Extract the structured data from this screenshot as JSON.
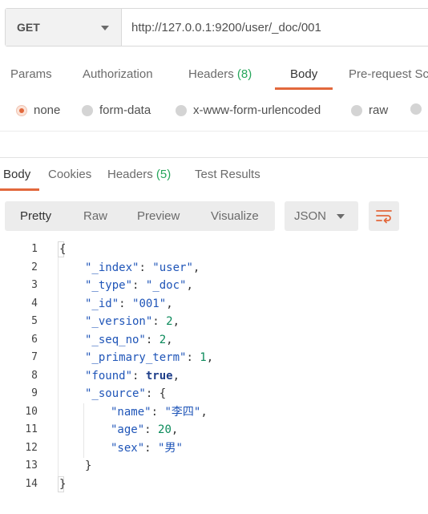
{
  "request": {
    "method": "GET",
    "url": "http://127.0.0.1:9200/user/_doc/001"
  },
  "request_tabs": [
    {
      "label": "Params"
    },
    {
      "label": "Authorization"
    },
    {
      "label": "Headers",
      "count": "(8)"
    },
    {
      "label": "Body",
      "active": true
    },
    {
      "label": "Pre-request Sc"
    }
  ],
  "body_types": [
    {
      "label": "none",
      "selected": true
    },
    {
      "label": "form-data"
    },
    {
      "label": "x-www-form-urlencoded"
    },
    {
      "label": "raw"
    }
  ],
  "response_tabs": [
    {
      "label": "Body",
      "active": true
    },
    {
      "label": "Cookies"
    },
    {
      "label": "Headers",
      "count": "(5)"
    },
    {
      "label": "Test Results"
    }
  ],
  "view_modes": [
    "Pretty",
    "Raw",
    "Preview",
    "Visualize"
  ],
  "format": "JSON",
  "accent_color": "#e2683c",
  "count_color": "#26a65b",
  "icons": {
    "method_dropdown": "chevron-down-icon",
    "format_dropdown": "chevron-down-icon",
    "wrap": "wrap-lines-icon"
  },
  "response_json": {
    "_index": "user",
    "_type": "_doc",
    "_id": "001",
    "_version": 2,
    "_seq_no": 2,
    "_primary_term": 1,
    "found": true,
    "_source": {
      "name": "李四",
      "age": 20,
      "sex": "男"
    }
  },
  "line_numbers": [
    "1",
    "2",
    "3",
    "4",
    "5",
    "6",
    "7",
    "8",
    "9",
    "10",
    "11",
    "12",
    "13",
    "14"
  ]
}
